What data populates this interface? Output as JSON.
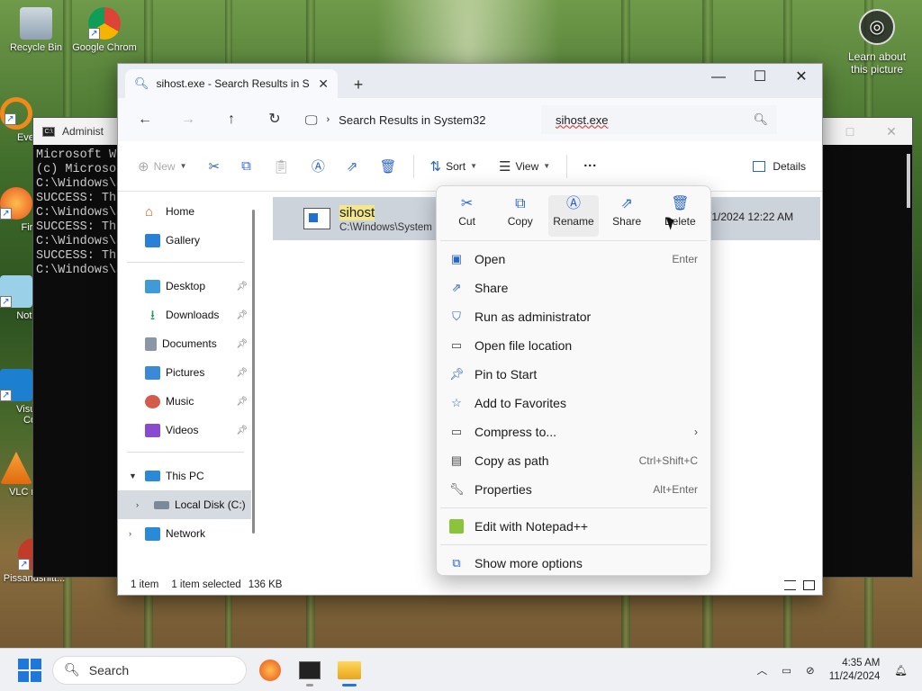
{
  "desktop": {
    "icons": [
      {
        "label": "Recycle Bin"
      },
      {
        "label": "Google Chrom"
      },
      {
        "label": "Every"
      },
      {
        "label": "Fire"
      },
      {
        "label": "Notep"
      },
      {
        "label": "Visual Co"
      },
      {
        "label": "VLC r pla"
      },
      {
        "label": "Pissandshitt..."
      }
    ],
    "learn": "Learn about this picture"
  },
  "console": {
    "title": "Administ",
    "lines": [
      "Microsoft W",
      "(c) Microso",
      "",
      "C:\\Windows\\S",
      "",
      "SUCCESS: The",
      "",
      "C:\\Windows\\S",
      "",
      "SUCCESS: The",
      "",
      "C:\\Windows\\S",
      "",
      "SUCCESS: The",
      "",
      "C:\\Windows\\S"
    ]
  },
  "explorer": {
    "tab_title": "sihost.exe - Search Results in S",
    "address": "Search Results in System32",
    "search_value": "sihost.exe",
    "commands": {
      "new": "New",
      "sort": "Sort",
      "view": "View",
      "details": "Details"
    },
    "nav": {
      "home": "Home",
      "gallery": "Gallery",
      "desktop": "Desktop",
      "downloads": "Downloads",
      "documents": "Documents",
      "pictures": "Pictures",
      "music": "Music",
      "videos": "Videos",
      "this_pc": "This PC",
      "local_disk": "Local Disk (C:)",
      "network": "Network"
    },
    "file": {
      "name": "sihost",
      "path": "C:\\Windows\\System",
      "date": "/1/2024 12:22 AM"
    },
    "status": {
      "count": "1 item",
      "selected": "1 item selected",
      "size": "136 KB"
    }
  },
  "context_menu": {
    "quick": {
      "cut": "Cut",
      "copy": "Copy",
      "rename": "Rename",
      "share": "Share",
      "delete": "Delete"
    },
    "items": {
      "open": "Open",
      "open_sc": "Enter",
      "share": "Share",
      "run_admin": "Run as administrator",
      "open_location": "Open file location",
      "pin_start": "Pin to Start",
      "favorites": "Add to Favorites",
      "compress": "Compress to...",
      "copy_path": "Copy as path",
      "copy_path_sc": "Ctrl+Shift+C",
      "properties": "Properties",
      "properties_sc": "Alt+Enter",
      "notepad": "Edit with Notepad++",
      "more": "Show more options"
    }
  },
  "taskbar": {
    "search_placeholder": "Search",
    "time": "4:35 AM",
    "date": "11/24/2024"
  }
}
